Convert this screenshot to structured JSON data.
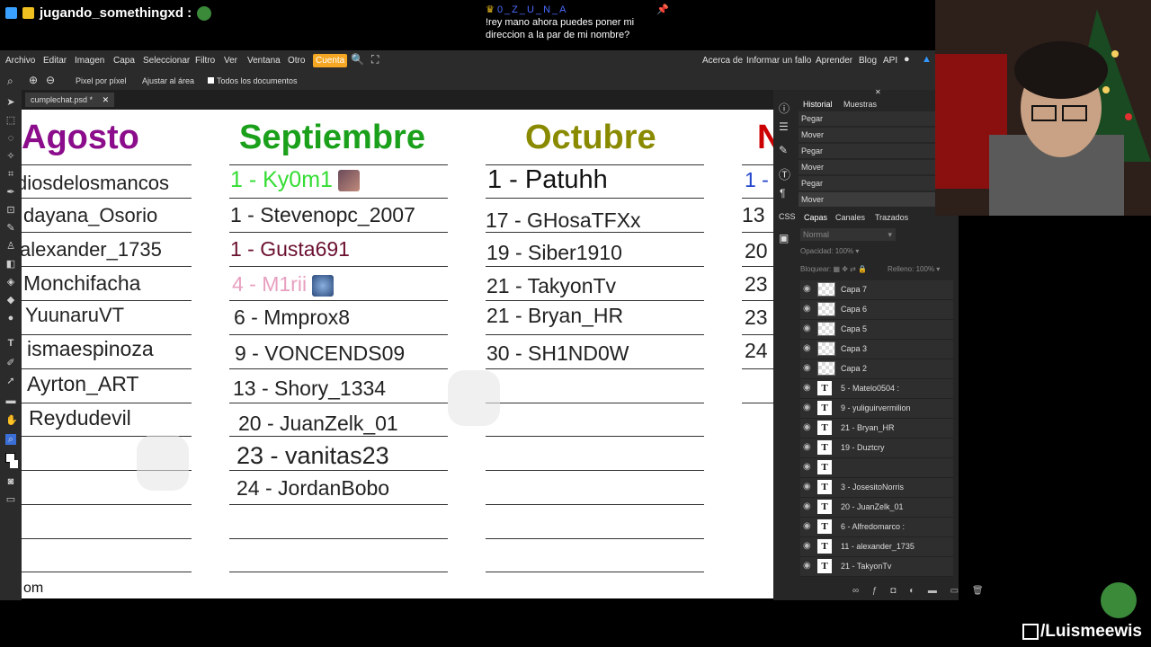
{
  "stream": {
    "streamer_name": "jugando_somethingxd :",
    "chat_user": "0_Z_U_N_A",
    "chat_message": "!rey mano ahora puedes poner mi direccion a la par de mi nombre?",
    "brand": "/Luismeewis"
  },
  "menu": {
    "items": [
      "Archivo",
      "Editar",
      "Imagen",
      "Capa",
      "Seleccionar",
      "Filtro",
      "Ver",
      "Ventana",
      "Otro"
    ],
    "account": "Cuenta",
    "right_items": [
      "Acerca de",
      "Informar un fallo",
      "Aprender",
      "Blog",
      "API"
    ]
  },
  "options": {
    "pixel": "Pixel por píxel",
    "fit": "Ajustar al área",
    "all_docs": "Todos los documentos"
  },
  "document": {
    "tab": "cumplechat.psd *"
  },
  "calendar": {
    "months": [
      {
        "name": "Agosto",
        "color": "#8b0d8b"
      },
      {
        "name": "Septiembre",
        "color": "#1aa01a"
      },
      {
        "name": "Octubre",
        "color": "#8a8a00"
      },
      {
        "name": "N",
        "color": "#cc0000"
      }
    ],
    "agosto": [
      "diosdelosmancos",
      "dayana_Osorio",
      "alexander_1735",
      "Monchifacha",
      "YuunaruVT",
      "ismaespinoza",
      "Ayrton_ART",
      "Reydudevil"
    ],
    "septiembre": [
      "1 - Ky0m1",
      "1 - Stevenopc_2007",
      "1 - Gusta691",
      "4 - M1rii",
      "6 - Mmprox8",
      "9 - VONCENDS09",
      "13 - Shory_1334",
      "20 - JuanZelk_01",
      "23 - vanitas23",
      "24 - JordanBobo"
    ],
    "octubre": [
      "1 - Patuhh",
      "17 - GHosaTFXx",
      "19 - Siber1910",
      "21 - TakyonTv",
      "21 - Bryan_HR",
      "30 - SH1ND0W"
    ],
    "noviembre": [
      "1 -",
      "13",
      "20",
      "23",
      "23",
      "24"
    ],
    "footer": "om",
    "colors": {
      "ky0m1": "#33dd33",
      "gusta": "#6b1030",
      "mirii": "#e8a0c0",
      "patuhh": "#111111",
      "nov1": "#2244cc"
    }
  },
  "panels": {
    "history_tab": "Historial",
    "swatches_tab": "Muestras",
    "history": [
      "Pegar",
      "Mover",
      "Pegar",
      "Mover",
      "Pegar",
      "Mover"
    ],
    "layers_tab": "Capas",
    "channels_tab": "Canales",
    "paths_tab": "Trazados",
    "blend_mode": "Normal",
    "opacity_label": "Opacidad:",
    "opacity": "100%",
    "lock_label": "Bloquear:",
    "fill_label": "Relleno:",
    "fill": "100%",
    "layers": [
      {
        "name": "Capa 7",
        "kind": "raster"
      },
      {
        "name": "Capa 6",
        "kind": "raster"
      },
      {
        "name": "Capa 5",
        "kind": "raster"
      },
      {
        "name": "Capa 3",
        "kind": "raster"
      },
      {
        "name": "Capa 2",
        "kind": "raster"
      },
      {
        "name": "5 - Matelo0504 :",
        "kind": "text"
      },
      {
        "name": "9 - yuliguirvermilion",
        "kind": "text"
      },
      {
        "name": "21 - Bryan_HR",
        "kind": "text"
      },
      {
        "name": "19 - Duztcry",
        "kind": "text"
      },
      {
        "name": "",
        "kind": "text"
      },
      {
        "name": "3 - JosesitoNorris",
        "kind": "text"
      },
      {
        "name": "20 - JuanZelk_01",
        "kind": "text"
      },
      {
        "name": "6 - Alfredomarco :",
        "kind": "text"
      },
      {
        "name": "11 - alexander_1735",
        "kind": "text"
      },
      {
        "name": "21 - TakyonTv",
        "kind": "text"
      }
    ]
  }
}
